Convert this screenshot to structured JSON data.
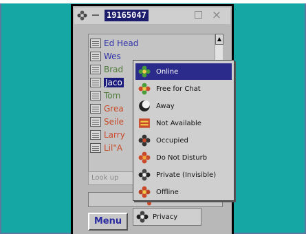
{
  "window": {
    "uin": "19165047"
  },
  "contacts": [
    {
      "name": "Ed Head",
      "color": "#2f2fa8"
    },
    {
      "name": "Wes",
      "color": "#2f2fa8"
    },
    {
      "name": "Brad",
      "color": "#4e7a3a"
    },
    {
      "name": "Jaco",
      "color": "#ffffff"
    },
    {
      "name": "Tom",
      "color": "#4e7a3a"
    },
    {
      "name": "Grea",
      "color": "#c84a2a"
    },
    {
      "name": "Seile",
      "color": "#c84a2a"
    },
    {
      "name": "Larry",
      "color": "#c84a2a"
    },
    {
      "name": "Lil\"A",
      "color": "#c84a2a"
    }
  ],
  "search": {
    "placeholder": "Look up"
  },
  "menu_button": {
    "label": "Menu"
  },
  "status_menu": {
    "items": [
      {
        "label": "Online",
        "icon": "flower-green-icon",
        "selected": true
      },
      {
        "label": "Free for Chat",
        "icon": "flower-chat-icon",
        "selected": false
      },
      {
        "label": "Away",
        "icon": "moon-away-icon",
        "selected": false
      },
      {
        "label": "Not Available",
        "icon": "na-icon",
        "selected": false
      },
      {
        "label": "Occupied",
        "icon": "flower-occupied-icon",
        "selected": false
      },
      {
        "label": "Do Not Disturb",
        "icon": "flower-dnd-icon",
        "selected": false
      },
      {
        "label": "Private (Invisible)",
        "icon": "invisible-icon",
        "selected": false
      },
      {
        "label": "Offline",
        "icon": "flower-offline-icon",
        "selected": false
      }
    ],
    "privacy_label": "Privacy"
  },
  "colors": {
    "background": "#15a7a4",
    "highlight": "#2b2b8c",
    "online_green": "#4a9c3a",
    "away_red": "#c84a2a"
  }
}
